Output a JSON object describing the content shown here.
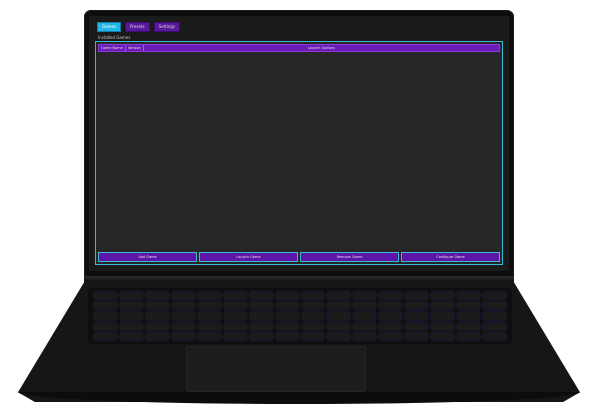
{
  "tabs": [
    {
      "label": "Games"
    },
    {
      "label": "Presets"
    },
    {
      "label": "Settings"
    }
  ],
  "section_label": "Installed Games",
  "table": {
    "headers": [
      "Game Name",
      "Version",
      "Launch Options"
    ]
  },
  "buttons": {
    "add_game": "Add Game",
    "launch_game": "Launch Game",
    "remove_game": "Remove Game",
    "configure_game": "Configure Game"
  },
  "colors": {
    "accent_purple": "#5a189a",
    "accent_cyan": "#22b6e6",
    "panel_bg": "#262626"
  }
}
